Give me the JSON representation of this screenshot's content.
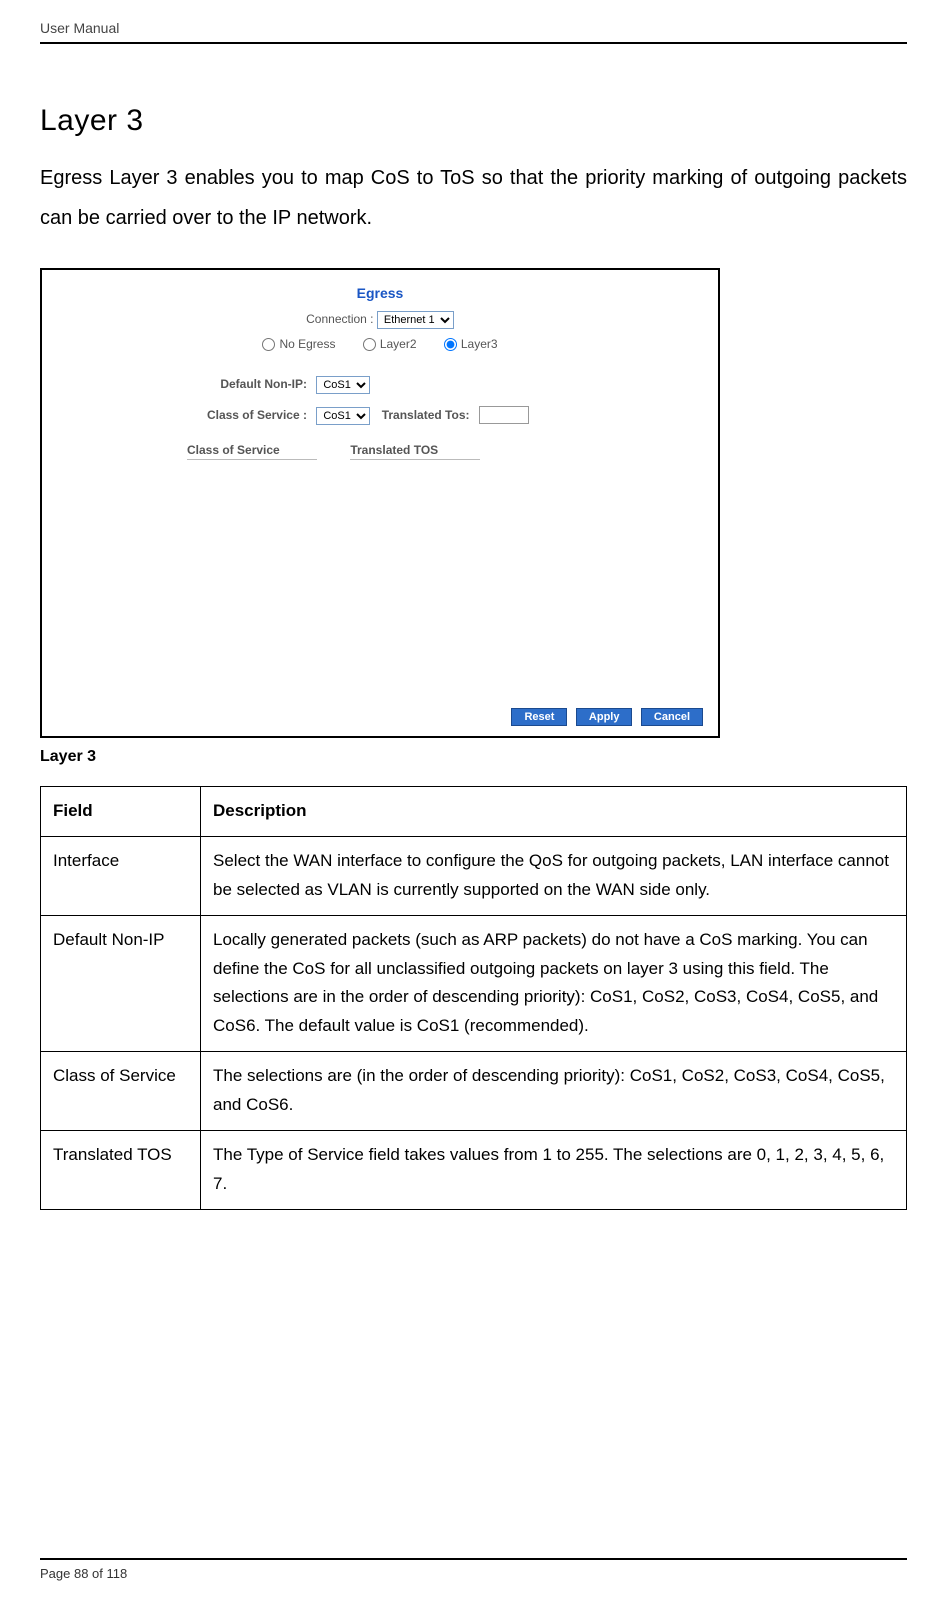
{
  "header": {
    "title": "User Manual"
  },
  "section": {
    "title": "Layer 3",
    "intro": "Egress Layer 3 enables you to map CoS to ToS so that the priority marking of outgoing packets can be carried over to the IP network."
  },
  "screenshot": {
    "title": "Egress",
    "connection_label": "Connection :",
    "connection_value": "Ethernet 1",
    "radio_no_egress": "No Egress",
    "radio_layer2": "Layer2",
    "radio_layer3": "Layer3",
    "default_nonip_label": "Default Non-IP:",
    "default_nonip_value": "CoS1",
    "cos_label": "Class of Service :",
    "cos_value": "CoS1",
    "translated_tos_label": "Translated Tos:",
    "translated_tos_value": "",
    "col_cos": "Class of Service",
    "col_ttos": "Translated TOS",
    "btn_reset": "Reset",
    "btn_apply": "Apply",
    "btn_cancel": "Cancel"
  },
  "caption": "Layer 3",
  "table": {
    "h_field": "Field",
    "h_desc": "Description",
    "rows": [
      {
        "field": "Interface",
        "desc": "Select the WAN interface to configure the QoS for outgoing packets, LAN interface cannot be selected as VLAN is currently supported on the WAN side only."
      },
      {
        "field": "Default Non-IP",
        "desc": "Locally generated packets (such as ARP packets) do not have a CoS marking. You can define the CoS for all unclassified outgoing packets on layer 3 using this field. The selections are in the order of descending priority): CoS1, CoS2, CoS3, CoS4, CoS5, and CoS6. The default value is CoS1 (recommended)."
      },
      {
        "field": "Class of Service",
        "desc": "The selections are (in the order of descending priority): CoS1, CoS2, CoS3, CoS4, CoS5, and CoS6."
      },
      {
        "field": "Translated TOS",
        "desc": "The Type of Service field takes values from 1 to 255. The selections are 0, 1, 2, 3, 4, 5, 6, 7."
      }
    ]
  },
  "footer": {
    "page": "Page 88 of 118"
  }
}
